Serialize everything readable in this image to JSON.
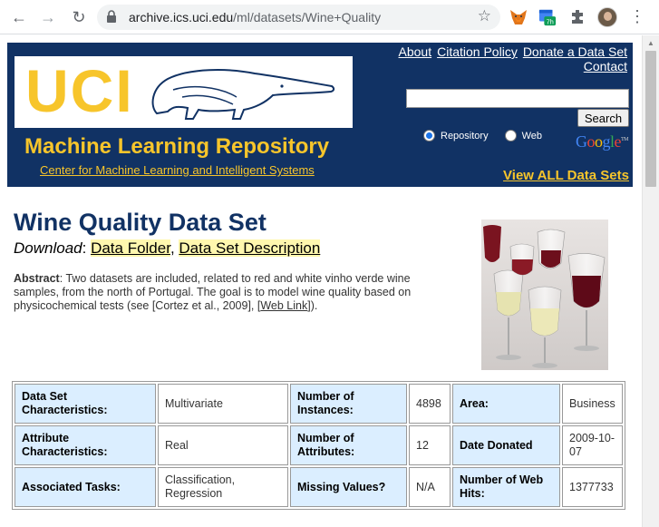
{
  "browser": {
    "url_host": "archive.ics.uci.edu",
    "url_path": "/ml/datasets/Wine+Quality",
    "ext_badge": "7h"
  },
  "header": {
    "logo_text": "UCI",
    "repo_title": "Machine Learning Repository",
    "repo_subtitle": "Center for Machine Learning and Intelligent Systems",
    "links": {
      "about": "About",
      "citation": "Citation Policy",
      "donate": "Donate a Data Set",
      "contact": "Contact"
    },
    "search_button": "Search",
    "search_value": "",
    "radio_repository": "Repository",
    "radio_web": "Web",
    "view_all": "View ALL Data Sets",
    "colors": {
      "navy": "#113264",
      "gold": "#f7c52b"
    }
  },
  "dataset": {
    "title": "Wine Quality Data Set",
    "download_label": "Download",
    "download_sep": ": ",
    "data_folder": "Data Folder",
    "comma": ", ",
    "description": "Data Set Description",
    "abstract_label": "Abstract",
    "abstract_text": ": Two datasets are included, related to red and white vinho verde wine samples, from the north of Portugal. The goal is to model wine quality based on physicochemical tests (see [Cortez et al., 2009], [",
    "web_link": "Web Link",
    "abstract_end": "])."
  },
  "table": {
    "rows": [
      [
        {
          "label": "Data Set Characteristics:",
          "value": "Multivariate"
        },
        {
          "label": "Number of Instances:",
          "value": "4898"
        },
        {
          "label": "Area:",
          "value": "Business"
        }
      ],
      [
        {
          "label": "Attribute Characteristics:",
          "value": "Real"
        },
        {
          "label": "Number of Attributes:",
          "value": "12"
        },
        {
          "label": "Date Donated",
          "value": "2009-10-07"
        }
      ],
      [
        {
          "label": "Associated Tasks:",
          "value": "Classification, Regression"
        },
        {
          "label": "Missing Values?",
          "value": "N/A"
        },
        {
          "label": "Number of Web Hits:",
          "value": "1377733"
        }
      ]
    ]
  }
}
